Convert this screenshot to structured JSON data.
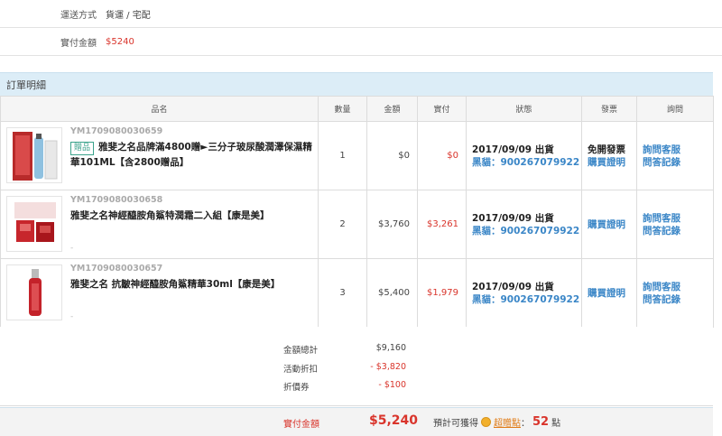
{
  "info": {
    "shipping_label": "運送方式",
    "shipping_value": "貨運 / 宅配",
    "paid_label": "實付金額",
    "paid_value": "$5240"
  },
  "section_title": "訂單明細",
  "headers": {
    "product": "品名",
    "qty": "數量",
    "amount": "金額",
    "paid": "實付",
    "status": "狀態",
    "invoice": "發票",
    "inquiry": "詢問"
  },
  "rows": [
    {
      "sku": "YM1709080030659",
      "badge": "贈品",
      "name": "雅斐之名品牌滿4800贈►三分子玻尿酸潤澤保濕精華101ML【含2800贈品】",
      "qty": "1",
      "amount": "$0",
      "paid": "$0",
      "status_date": "2017/09/09 出貨",
      "tracking": "黑貓：900267079922",
      "invoice_text": "免開發票",
      "invoice_link": "購買證明",
      "inquiry_link1": "詢問客服",
      "inquiry_link2": "問答記錄"
    },
    {
      "sku": "YM1709080030658",
      "badge": "",
      "name": "雅斐之名神經醯胺角鯊特潤霜二入組【康是美】",
      "qty": "2",
      "amount": "$3,760",
      "paid": "$3,261",
      "status_date": "2017/09/09 出貨",
      "tracking": "黑貓：900267079922",
      "invoice_text": "",
      "invoice_link": "購買證明",
      "inquiry_link1": "詢問客服",
      "inquiry_link2": "問答記錄",
      "dash": "-"
    },
    {
      "sku": "YM1709080030657",
      "badge": "",
      "name": "雅斐之名 抗皺神經醯胺角鯊精華30ml【康是美】",
      "qty": "3",
      "amount": "$5,400",
      "paid": "$1,979",
      "status_date": "2017/09/09 出貨",
      "tracking": "黑貓：900267079922",
      "invoice_text": "",
      "invoice_link": "購買證明",
      "inquiry_link1": "詢問客服",
      "inquiry_link2": "問答記錄",
      "dash": "-"
    }
  ],
  "summary": {
    "subtotal_label": "金額總計",
    "subtotal_value": "$9,160",
    "discount_label": "活動折扣",
    "discount_value": "- $3,820",
    "coupon_label": "折價券",
    "coupon_value": "- $100"
  },
  "total": {
    "label": "實付金額",
    "value": "$5,240",
    "points_prefix": "預計可獲得",
    "points_link": "超贈點",
    "points_sep": "：",
    "points_num": "52",
    "points_unit": "點"
  },
  "colors": {
    "accent_red": "#d9342b",
    "link_blue": "#3a86c7",
    "section_bg": "#dcedf7"
  }
}
